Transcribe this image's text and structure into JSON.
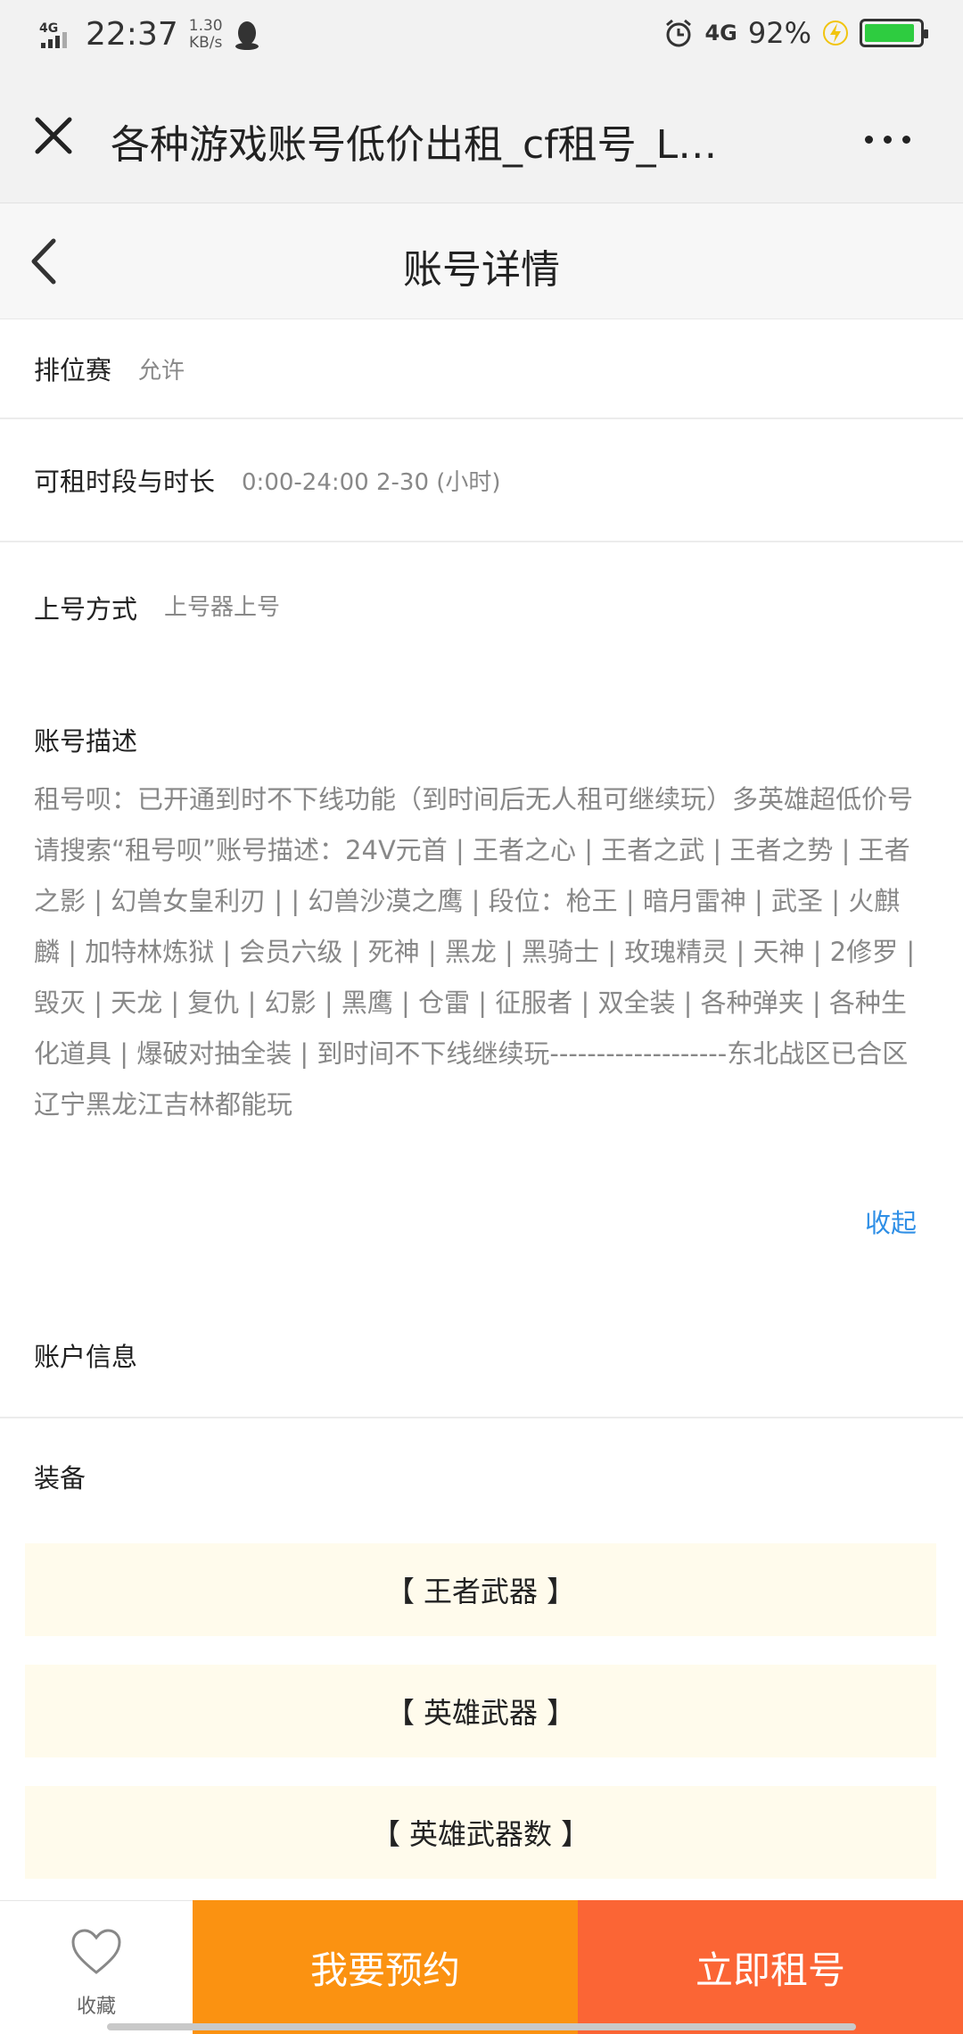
{
  "status_bar": {
    "network": "4G",
    "time": "22:37",
    "speed_value": "1.30",
    "speed_unit": "KB/s",
    "network_right": "4G",
    "battery_pct": "92%",
    "battery_level": 0.92,
    "icons": [
      "signal-icon",
      "qq-icon",
      "alarm-icon",
      "charging-icon",
      "battery-icon"
    ]
  },
  "browser": {
    "title": "各种游戏账号低价出租_cf租号_L…",
    "close_icon": "close-icon",
    "more_icon": "more-icon"
  },
  "nav": {
    "title": "账号详情",
    "back_icon": "back-chevron-icon"
  },
  "details": [
    {
      "label": "排位赛",
      "value": "允许"
    },
    {
      "label": "可租时段与时长",
      "value": "0:00-24:00 2-30 (小时)"
    },
    {
      "label": "上号方式",
      "value": "上号器上号"
    }
  ],
  "description": {
    "label": "账号描述",
    "text": "租号呗：已开通到时不下线功能（到时间后无人租可继续玩）多英雄超低价号请搜索“租号呗”账号描述：24V元首 | 王者之心 | 王者之武 | 王者之势 | 王者之影 | 幻兽女皇利刃 | | 幻兽沙漠之鹰 | 段位：枪王 | 暗月雷神 | 武圣 | 火麒麟 | 加特林炼狱 | 会员六级 | 死神 | 黑龙 | 黑骑士 | 玫瑰精灵 | 天神 | 2修罗 | 毁灭 | 天龙 | 复仇 | 幻影 | 黑鹰 | 仓雷 | 征服者 | 双全装 | 各种弹夹 | 各种生化道具 | 爆破对抽全装 | 到时间不下线继续玩-------------------东北战区已合区辽宁黑龙江吉林都能玩",
    "collapse_label": "收起"
  },
  "account_info": {
    "label": "账户信息"
  },
  "equipment": {
    "label": "装备",
    "items": [
      "【 王者武器 】",
      "【 英雄武器 】",
      "【 英雄武器数 】"
    ]
  },
  "bottom": {
    "favorite_label": "收藏",
    "favorite_icon": "heart-icon",
    "reserve_label": "我要预约",
    "rent_label": "立即租号",
    "colors": {
      "reserve": "#fb9211",
      "rent": "#fb6535"
    }
  }
}
